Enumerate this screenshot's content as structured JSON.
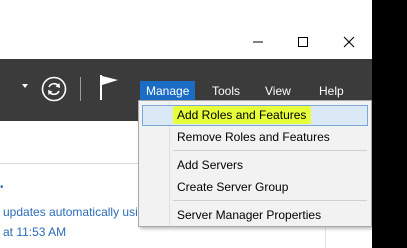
{
  "window": {
    "controls": {
      "minimize_icon": "minimize-icon",
      "maximize_icon": "maximize-icon",
      "close_icon": "close-icon"
    }
  },
  "toolbar": {
    "refresh_icon": "refresh-icon",
    "flag_icon": "flag-icon",
    "menu": {
      "manage": "Manage",
      "tools": "Tools",
      "view": "View",
      "help": "Help"
    },
    "active_menu_color": "#1b6cc4",
    "background_color": "#3b3b3b"
  },
  "manage_menu": {
    "items": [
      "Add Roles and Features",
      "Remove Roles and Features",
      "Add Servers",
      "Create Server Group",
      "Server Manager Properties"
    ],
    "highlight_color": "#e6ff3a"
  },
  "content": {
    "bullet": "•",
    "line1": "updates automatically usi",
    "line2": "at 11:53 AM"
  }
}
